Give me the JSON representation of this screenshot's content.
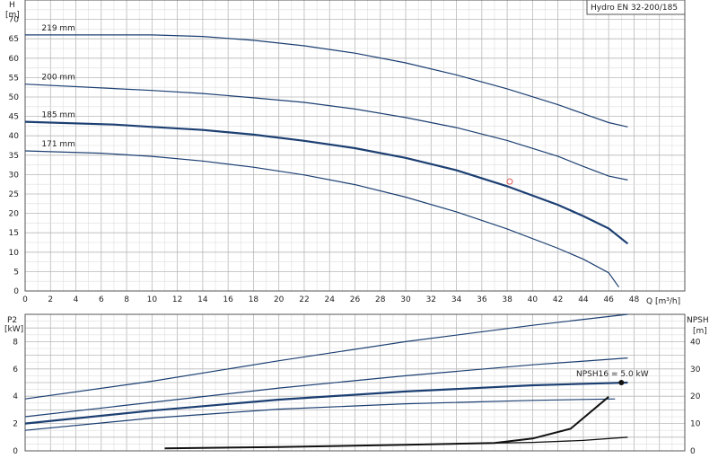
{
  "chart_data": [
    {
      "type": "line",
      "title": "Hydro EN 32-200/185",
      "ylabel_top": "H",
      "ylabel_unit": "[m]",
      "xlabel": "Q [m³/h]",
      "xlim": [
        0,
        52
      ],
      "ylim": [
        0,
        75
      ],
      "x_ticks": [
        0,
        2,
        4,
        6,
        8,
        10,
        12,
        14,
        16,
        18,
        20,
        22,
        24,
        26,
        28,
        30,
        32,
        34,
        36,
        38,
        40,
        42,
        44,
        46,
        48
      ],
      "y_ticks": [
        0,
        5,
        10,
        15,
        20,
        25,
        30,
        35,
        40,
        45,
        50,
        55,
        60,
        65,
        70
      ],
      "grid": true,
      "series": [
        {
          "name": "219 mm",
          "bold": false,
          "points": [
            [
              0,
              66
            ],
            [
              10,
              66
            ],
            [
              14,
              65.6
            ],
            [
              18,
              64.6
            ],
            [
              22,
              63.2
            ],
            [
              26,
              61.3
            ],
            [
              30,
              58.8
            ],
            [
              34,
              55.7
            ],
            [
              38,
              52.1
            ],
            [
              42,
              48
            ],
            [
              44,
              45.7
            ],
            [
              46,
              43.4
            ],
            [
              47.5,
              42.3
            ]
          ]
        },
        {
          "name": "200 mm",
          "bold": false,
          "points": [
            [
              0,
              53.3
            ],
            [
              10,
              51.7
            ],
            [
              14,
              50.9
            ],
            [
              18,
              49.8
            ],
            [
              22,
              48.6
            ],
            [
              26,
              46.9
            ],
            [
              30,
              44.7
            ],
            [
              34,
              42.1
            ],
            [
              38,
              38.8
            ],
            [
              42,
              34.7
            ],
            [
              44,
              32.1
            ],
            [
              46,
              29.6
            ],
            [
              47.5,
              28.6
            ]
          ]
        },
        {
          "name": "185 mm",
          "bold": true,
          "points": [
            [
              0,
              43.6
            ],
            [
              7,
              42.9
            ],
            [
              10,
              42.3
            ],
            [
              14,
              41.5
            ],
            [
              18,
              40.3
            ],
            [
              22,
              38.7
            ],
            [
              26,
              36.8
            ],
            [
              30,
              34.3
            ],
            [
              34,
              31.1
            ],
            [
              38,
              27
            ],
            [
              42,
              22.2
            ],
            [
              44,
              19.3
            ],
            [
              46,
              16.1
            ],
            [
              47.5,
              12.2
            ]
          ]
        },
        {
          "name": "171 mm",
          "bold": false,
          "points": [
            [
              0,
              36.1
            ],
            [
              6,
              35.5
            ],
            [
              10,
              34.7
            ],
            [
              14,
              33.5
            ],
            [
              18,
              31.9
            ],
            [
              22,
              29.9
            ],
            [
              26,
              27.4
            ],
            [
              30,
              24.2
            ],
            [
              34,
              20.4
            ],
            [
              38,
              16
            ],
            [
              42,
              11
            ],
            [
              44,
              8.2
            ],
            [
              46,
              4.7
            ],
            [
              46.8,
              1
            ]
          ]
        }
      ],
      "duty_point": {
        "x": 38.2,
        "y": 28.2,
        "color": "#e05050"
      }
    },
    {
      "type": "line",
      "ylabel_left": "P2",
      "ylabel_left_unit": "[kW]",
      "ylabel_right": "NPSH",
      "ylabel_right_unit": "[m]",
      "xlim": [
        0,
        52
      ],
      "ylim_left": [
        0,
        10
      ],
      "ylim_right": [
        0,
        50
      ],
      "y_ticks_left": [
        0,
        2,
        4,
        6,
        8
      ],
      "y_ticks_right": [
        0,
        10,
        20,
        30,
        40
      ],
      "grid": true,
      "power_series": [
        {
          "bold": false,
          "points": [
            [
              0,
              3.8
            ],
            [
              10,
              5.1
            ],
            [
              20,
              6.6
            ],
            [
              30,
              8
            ],
            [
              40,
              9.2
            ],
            [
              47.5,
              10
            ]
          ]
        },
        {
          "bold": false,
          "points": [
            [
              0,
              2.5
            ],
            [
              10,
              3.55
            ],
            [
              20,
              4.6
            ],
            [
              30,
              5.5
            ],
            [
              40,
              6.3
            ],
            [
              47.5,
              6.8
            ]
          ]
        },
        {
          "bold": true,
          "points": [
            [
              0,
              2
            ],
            [
              10,
              2.95
            ],
            [
              20,
              3.75
            ],
            [
              30,
              4.35
            ],
            [
              40,
              4.8
            ],
            [
              47.5,
              5
            ]
          ]
        },
        {
          "bold": false,
          "points": [
            [
              0,
              1.5
            ],
            [
              10,
              2.4
            ],
            [
              20,
              3.05
            ],
            [
              30,
              3.45
            ],
            [
              40,
              3.7
            ],
            [
              46.5,
              3.8
            ]
          ]
        }
      ],
      "npsh_series": [
        {
          "bold": true,
          "points": [
            [
              11,
              0.9
            ],
            [
              20,
              1.4
            ],
            [
              30,
              2.2
            ],
            [
              37,
              2.9
            ],
            [
              40,
              4.5
            ],
            [
              43,
              8.1
            ],
            [
              46,
              19.8
            ]
          ]
        },
        {
          "bold": false,
          "points": [
            [
              33,
              2.5
            ],
            [
              40,
              3.1
            ],
            [
              44,
              3.8
            ],
            [
              47.5,
              5
            ]
          ]
        }
      ],
      "annotation": {
        "text": "NPSH16 = 5.0 kW",
        "x": 47,
        "y": 5
      }
    }
  ]
}
